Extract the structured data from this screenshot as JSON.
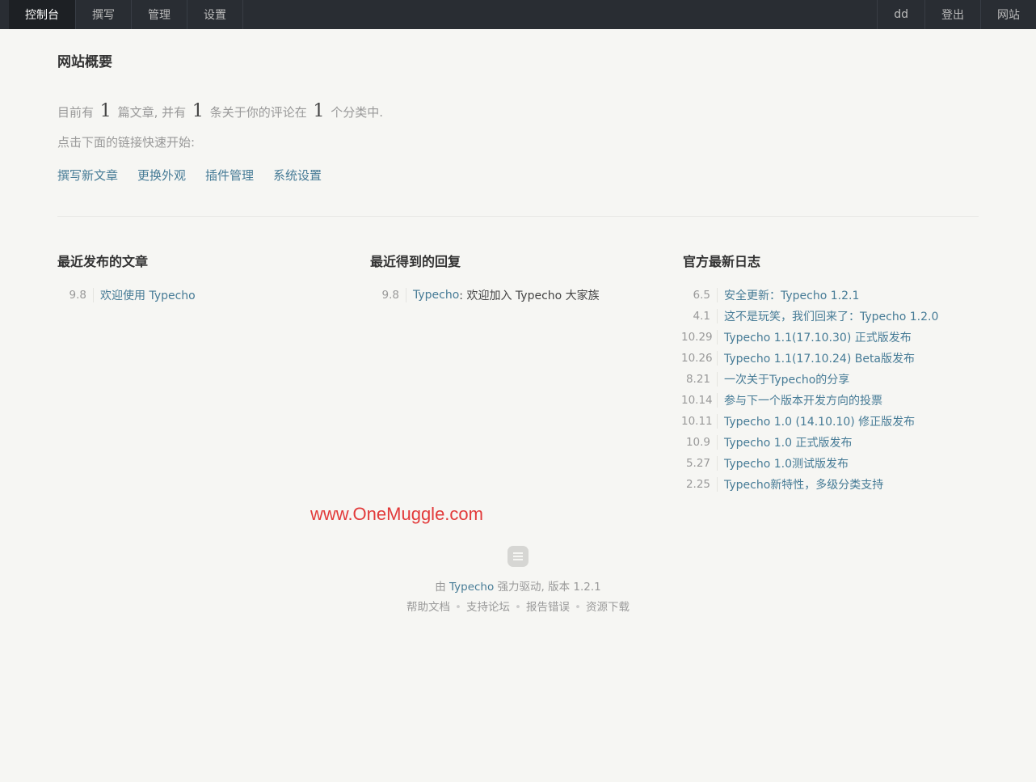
{
  "nav": {
    "left": [
      "控制台",
      "撰写",
      "管理",
      "设置"
    ],
    "right": [
      "dd",
      "登出",
      "网站"
    ]
  },
  "page_title": "网站概要",
  "summary": {
    "t1": "目前有",
    "posts": "1",
    "t2": "篇文章, 并有",
    "comments": "1",
    "t3": "条关于你的评论在",
    "categories": "1",
    "t4": "个分类中."
  },
  "hint": "点击下面的链接快速开始:",
  "quick_links": [
    "撰写新文章",
    "更换外观",
    "插件管理",
    "系统设置"
  ],
  "recent_posts": {
    "title": "最近发布的文章",
    "items": [
      {
        "date": "9.8",
        "title": "欢迎使用 Typecho"
      }
    ]
  },
  "recent_replies": {
    "title": "最近得到的回复",
    "items": [
      {
        "date": "9.8",
        "author": "Typecho",
        "text": ": 欢迎加入 Typecho 大家族"
      }
    ]
  },
  "official_log": {
    "title": "官方最新日志",
    "items": [
      {
        "date": "6.5",
        "title": "安全更新：Typecho 1.2.1"
      },
      {
        "date": "4.1",
        "title": "这不是玩笑，我们回来了：Typecho 1.2.0"
      },
      {
        "date": "10.29",
        "title": "Typecho 1.1(17.10.30) 正式版发布"
      },
      {
        "date": "10.26",
        "title": "Typecho 1.1(17.10.24) Beta版发布"
      },
      {
        "date": "8.21",
        "title": "一次关于Typecho的分享"
      },
      {
        "date": "10.14",
        "title": "参与下一个版本开发方向的投票"
      },
      {
        "date": "10.11",
        "title": "Typecho 1.0 (14.10.10) 修正版发布"
      },
      {
        "date": "10.9",
        "title": "Typecho 1.0 正式版发布"
      },
      {
        "date": "5.27",
        "title": "Typecho 1.0测试版发布"
      },
      {
        "date": "2.25",
        "title": "Typecho新特性，多级分类支持"
      }
    ]
  },
  "watermark": "www.OneMuggle.com",
  "footer": {
    "by": "由",
    "typecho": "Typecho",
    "powered": "强力驱动, 版本 1.2.1",
    "links": [
      "帮助文档",
      "支持论坛",
      "报告错误",
      "资源下载"
    ]
  },
  "colors": {
    "topbar": "#292d33",
    "link": "#467b96",
    "background": "#f6f6f3",
    "watermark": "#e23a3a"
  }
}
